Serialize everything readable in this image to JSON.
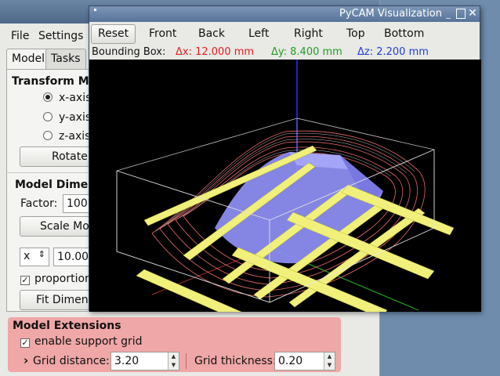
{
  "menu": {
    "file": "File",
    "settings": "Settings"
  },
  "tabs": [
    "Model",
    "Tasks"
  ],
  "transform": {
    "title": "Transform Mo",
    "axes": [
      {
        "label": "x-axis",
        "selected": true
      },
      {
        "label": "y-axis",
        "selected": false
      },
      {
        "label": "z-axis",
        "selected": false
      }
    ],
    "rotate_label": "Rotate"
  },
  "dimensions": {
    "title": "Model Dimen",
    "factor_label": "Factor:",
    "factor_value": "100",
    "scale_label": "Scale Mo",
    "axis_select": "x",
    "size_value": "10.00",
    "proportional_label": "proportion",
    "proportional_checked": true,
    "fit_label": "Fit Dimens"
  },
  "extensions": {
    "title": "Model Extensions",
    "enable_label": "enable support grid",
    "enable_checked": true,
    "expander": "›",
    "distance_label": "Grid distance:",
    "distance_value": "3.20",
    "thickness_label": "Grid thickness:",
    "thickness_value": "0.20"
  },
  "viz": {
    "title": "PyCAM Visualization",
    "buttons": [
      "Reset",
      "Front",
      "Back",
      "Left",
      "Right",
      "Top",
      "Bottom"
    ],
    "bbox_label": "Bounding Box:",
    "dx": "Δx: 12.000 mm",
    "dy": "Δy: 8.400 mm",
    "dz": "Δz: 2.200 mm",
    "colors": {
      "dx": "#e02020",
      "dy": "#20a020",
      "dz": "#2040d0",
      "model": "#8c8cf0",
      "grid": "#f0f07a",
      "toolpath": "#e66a6a"
    }
  }
}
